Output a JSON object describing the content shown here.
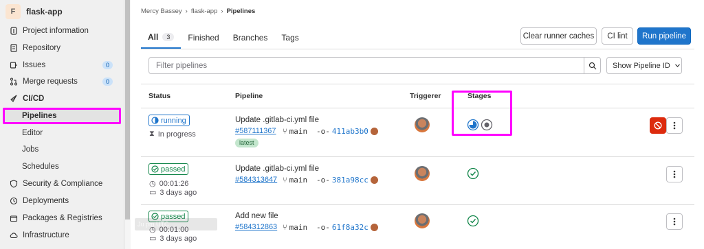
{
  "project": {
    "avatar_letter": "F",
    "name": "flask-app"
  },
  "sidebar": {
    "items": [
      {
        "label": "Project information",
        "icon": "info-icon"
      },
      {
        "label": "Repository",
        "icon": "doc-icon"
      },
      {
        "label": "Issues",
        "icon": "issues-icon",
        "badge": "0"
      },
      {
        "label": "Merge requests",
        "icon": "merge-request-icon",
        "badge": "0"
      },
      {
        "label": "CI/CD",
        "icon": "rocket-icon"
      },
      {
        "label": "Pipelines"
      },
      {
        "label": "Editor"
      },
      {
        "label": "Jobs"
      },
      {
        "label": "Schedules"
      },
      {
        "label": "Security & Compliance",
        "icon": "shield-icon"
      },
      {
        "label": "Deployments",
        "icon": "deployments-icon"
      },
      {
        "label": "Packages & Registries",
        "icon": "package-icon"
      },
      {
        "label": "Infrastructure",
        "icon": "cloud-icon"
      }
    ],
    "tooltip_ghost": "Ju                    pm UTC"
  },
  "breadcrumb": {
    "user": "Mercy Bassey",
    "project": "flask-app",
    "current": "Pipelines"
  },
  "tabs": {
    "all": "All",
    "all_count": "3",
    "finished": "Finished",
    "branches": "Branches",
    "tags": "Tags"
  },
  "buttons": {
    "clear_cache": "Clear runner caches",
    "ci_lint": "CI lint",
    "run_pipeline": "Run pipeline"
  },
  "filter": {
    "placeholder": "Filter pipelines",
    "show_id": "Show Pipeline ID"
  },
  "table": {
    "headers": {
      "status": "Status",
      "pipeline": "Pipeline",
      "triggerer": "Triggerer",
      "stages": "Stages"
    },
    "rows": [
      {
        "status": "running",
        "meta1": "In progress",
        "meta2": "",
        "title": "Update .gitlab-ci.yml file",
        "id": "#587111367",
        "branch": "main",
        "commit": "411ab3b0",
        "latest": "latest"
      },
      {
        "status": "passed",
        "meta1": "00:01:26",
        "meta2": "3 days ago",
        "title": "Update .gitlab-ci.yml file",
        "id": "#584313647",
        "branch": "main",
        "commit": "381a98cc"
      },
      {
        "status": "passed",
        "meta1": "00:01:00",
        "meta2": "3 days ago",
        "title": "Add new file",
        "id": "#584312863",
        "branch": "main",
        "commit": "61f8a32c"
      }
    ]
  },
  "colors": {
    "accent": "#1f75cb",
    "passed": "#108548",
    "danger": "#dd2b0e",
    "highlight": "#ff00ff"
  }
}
